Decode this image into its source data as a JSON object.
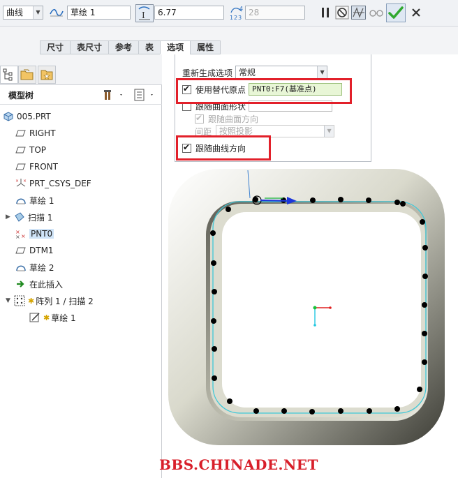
{
  "toolbar": {
    "type_dropdown": "曲线",
    "sketch_field": "草绘 1",
    "value_field": "6.77",
    "count_field": "28"
  },
  "tabs": [
    {
      "label": "尺寸",
      "active": false
    },
    {
      "label": "表尺寸",
      "active": false
    },
    {
      "label": "参考",
      "active": false
    },
    {
      "label": "表",
      "active": false
    },
    {
      "label": "选项",
      "active": true
    },
    {
      "label": "属性",
      "active": false
    }
  ],
  "model_tree": {
    "title": "模型树",
    "items": [
      {
        "label": "005.PRT",
        "icon": "part-icon"
      },
      {
        "label": "RIGHT",
        "icon": "datum-plane-icon"
      },
      {
        "label": "TOP",
        "icon": "datum-plane-icon"
      },
      {
        "label": "FRONT",
        "icon": "datum-plane-icon"
      },
      {
        "label": "PRT_CSYS_DEF",
        "icon": "csys-icon"
      },
      {
        "label": "草绘 1",
        "icon": "sketch-icon"
      },
      {
        "label": "扫描 1",
        "icon": "sweep-icon"
      },
      {
        "label": "PNT0",
        "icon": "datum-point-icon"
      },
      {
        "label": "DTM1",
        "icon": "datum-plane-icon"
      },
      {
        "label": "草绘 2",
        "icon": "sketch-icon"
      },
      {
        "label": "在此插入",
        "icon": "insert-here-icon"
      },
      {
        "label": "阵列 1 / 扫描 2",
        "icon": "pattern-icon"
      },
      {
        "label": "草绘 1",
        "icon": "sketch-edit-icon"
      }
    ]
  },
  "options": {
    "regen_label": "重新生成选项",
    "regen_value": "常规",
    "use_alt_origin_label": "使用替代原点",
    "alt_origin_value": "PNT0:F7(基准点)",
    "follow_surface_shape_label": "跟随曲面形状",
    "follow_surface_dir_label": "跟随曲面方向",
    "spacing_label": "间距",
    "spacing_value": "按照投影",
    "follow_curve_dir_label": "跟随曲线方向"
  },
  "watermark": "BBS.CHINADE.NET",
  "colors": {
    "highlight": "#e2202a",
    "confirm_green": "#2fa82f",
    "watermark": "#d81f2a"
  }
}
